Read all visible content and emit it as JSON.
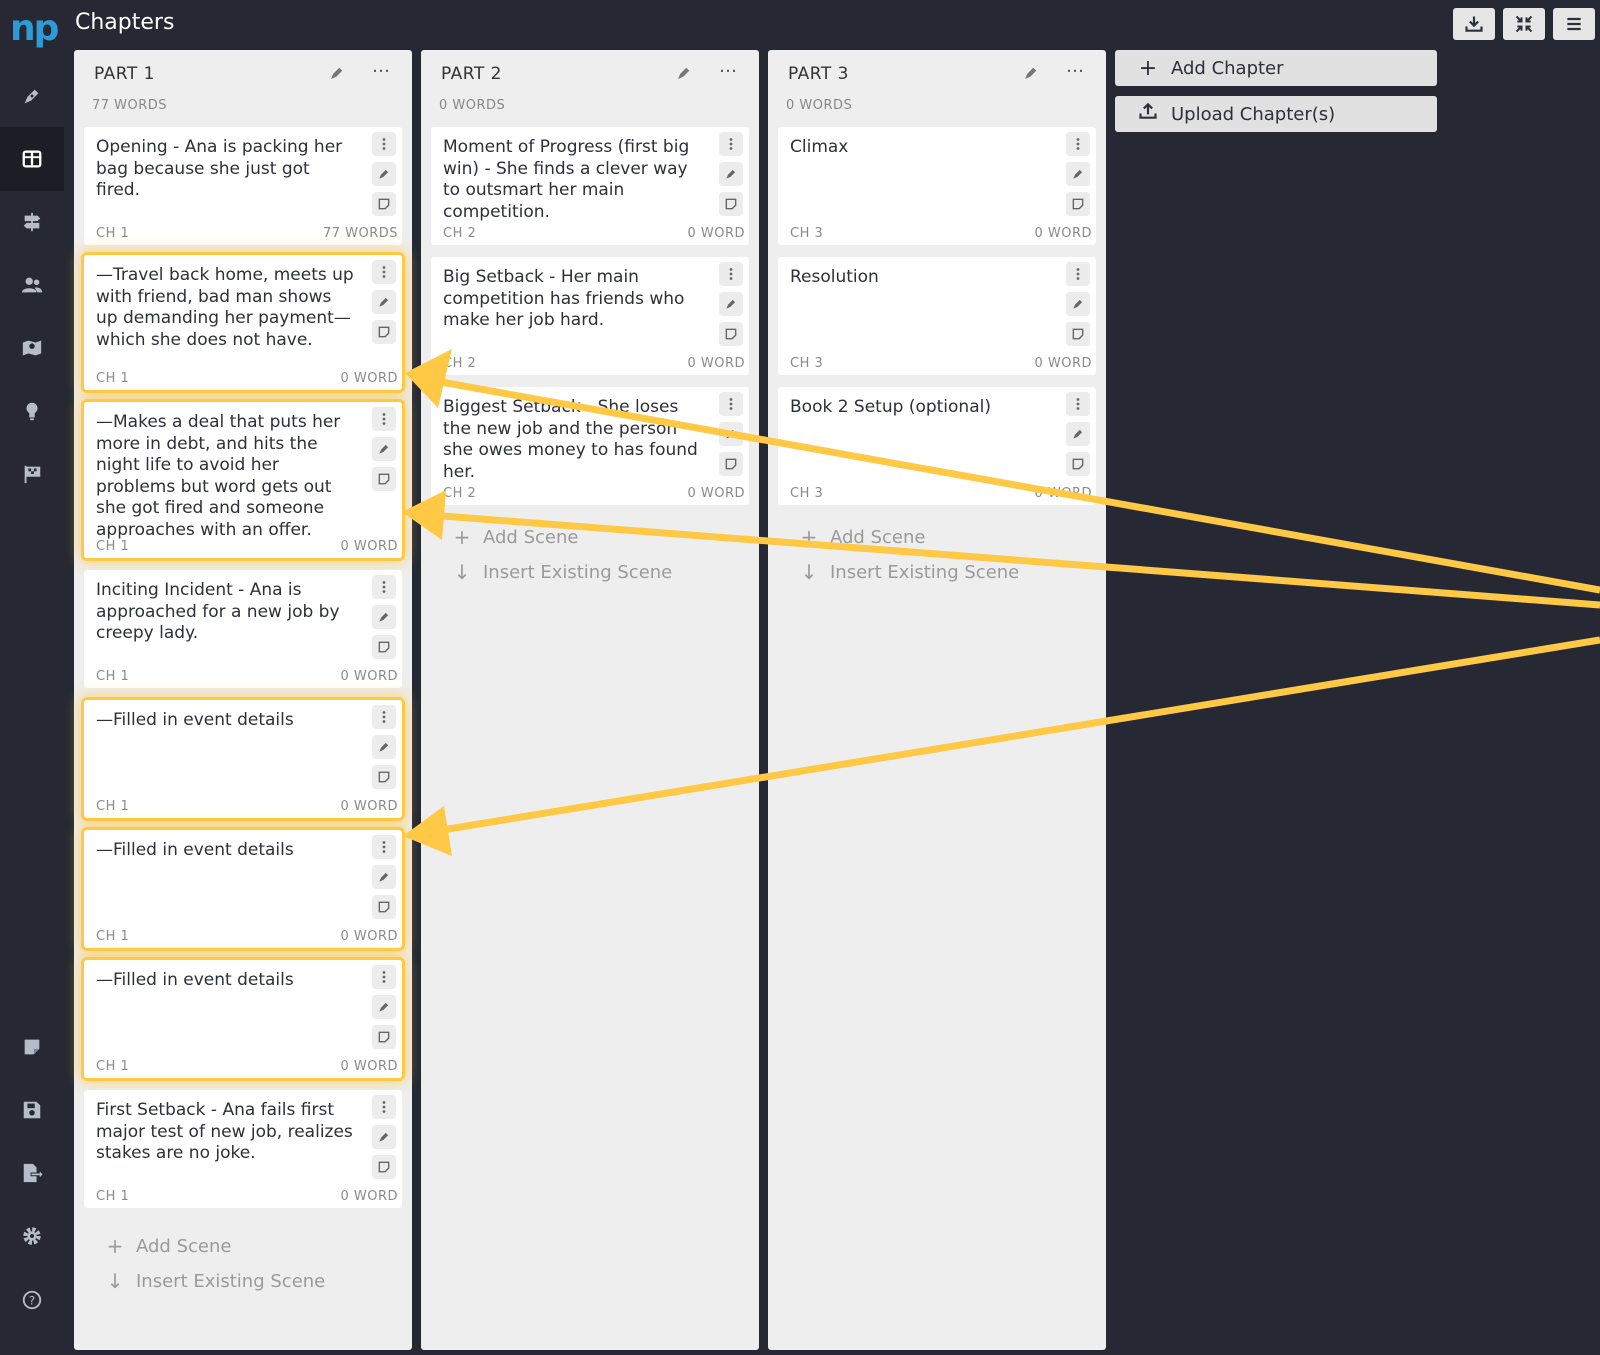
{
  "app": {
    "logo": "np",
    "title": "Chapters"
  },
  "sidebar": {
    "items": [
      {
        "icon": "pen-icon",
        "active": false
      },
      {
        "icon": "board-icon",
        "active": true
      },
      {
        "icon": "signpost-icon",
        "active": false
      },
      {
        "icon": "users-icon",
        "active": false
      },
      {
        "icon": "map-icon",
        "active": false
      },
      {
        "icon": "lightbulb-icon",
        "active": false
      },
      {
        "icon": "flag-icon",
        "active": false
      },
      {
        "icon": "note-icon",
        "active": false
      },
      {
        "icon": "save-icon",
        "active": false
      },
      {
        "icon": "export-icon",
        "active": false
      },
      {
        "icon": "settings-icon",
        "active": false
      },
      {
        "icon": "help-icon",
        "active": false
      }
    ]
  },
  "toolbar": {
    "buttons": [
      "download-icon",
      "collapse-icon",
      "menu-icon"
    ]
  },
  "parts": [
    {
      "title": "PART 1",
      "words": "77 WORDS",
      "scenes": [
        {
          "text": "Opening - Ana is packing her bag because she just got fired.",
          "ch": "CH 1",
          "wc": "77 WORDS",
          "highlight": false
        },
        {
          "text": "—Travel back home, meets up with friend, bad man shows up demanding her payment—which she does not have.",
          "ch": "CH 1",
          "wc": "0 WORD",
          "highlight": true
        },
        {
          "text": "—Makes a deal that puts her more in debt, and hits the night life to avoid her problems but word gets out she got fired and someone approaches with an offer.",
          "ch": "CH 1",
          "wc": "0 WORD",
          "highlight": true
        },
        {
          "text": "Inciting Incident - Ana is approached for a new job by creepy lady.",
          "ch": "CH 1",
          "wc": "0 WORD",
          "highlight": false
        },
        {
          "text": "—Filled in event details",
          "ch": "CH 1",
          "wc": "0 WORD",
          "highlight": true
        },
        {
          "text": "—Filled in event details",
          "ch": "CH 1",
          "wc": "0 WORD",
          "highlight": true
        },
        {
          "text": "—Filled in event details",
          "ch": "CH 1",
          "wc": "0 WORD",
          "highlight": true
        },
        {
          "text": "First Setback - Ana fails first major test of new job, realizes stakes are no joke.",
          "ch": "CH 1",
          "wc": "0 WORD",
          "highlight": false
        }
      ]
    },
    {
      "title": "PART 2",
      "words": "0 WORDS",
      "scenes": [
        {
          "text": "Moment of Progress (first big win) - She finds a clever way to outsmart her main competition.",
          "ch": "CH 2",
          "wc": "0 WORD",
          "highlight": false
        },
        {
          "text": "Big Setback - Her main competition has friends who make her job hard.",
          "ch": "CH 2",
          "wc": "0 WORD",
          "highlight": false
        },
        {
          "text": "Biggest Setback - She loses the new job and the person she owes money to has found her.",
          "ch": "CH 2",
          "wc": "0 WORD",
          "highlight": false
        }
      ]
    },
    {
      "title": "PART 3",
      "words": "0 WORDS",
      "scenes": [
        {
          "text": "Climax",
          "ch": "CH 3",
          "wc": "0 WORD",
          "highlight": false
        },
        {
          "text": "Resolution",
          "ch": "CH 3",
          "wc": "0 WORD",
          "highlight": false
        },
        {
          "text": "Book 2 Setup (optional)",
          "ch": "CH 3",
          "wc": "0 WORD",
          "highlight": false
        }
      ]
    }
  ],
  "column_actions": {
    "add_scene": "Add Scene",
    "insert_existing": "Insert Existing Scene"
  },
  "side_actions": {
    "add_chapter": "Add Chapter",
    "upload_chapters": "Upload Chapter(s)"
  },
  "annotation": {
    "arrow_color": "#ffc845"
  }
}
